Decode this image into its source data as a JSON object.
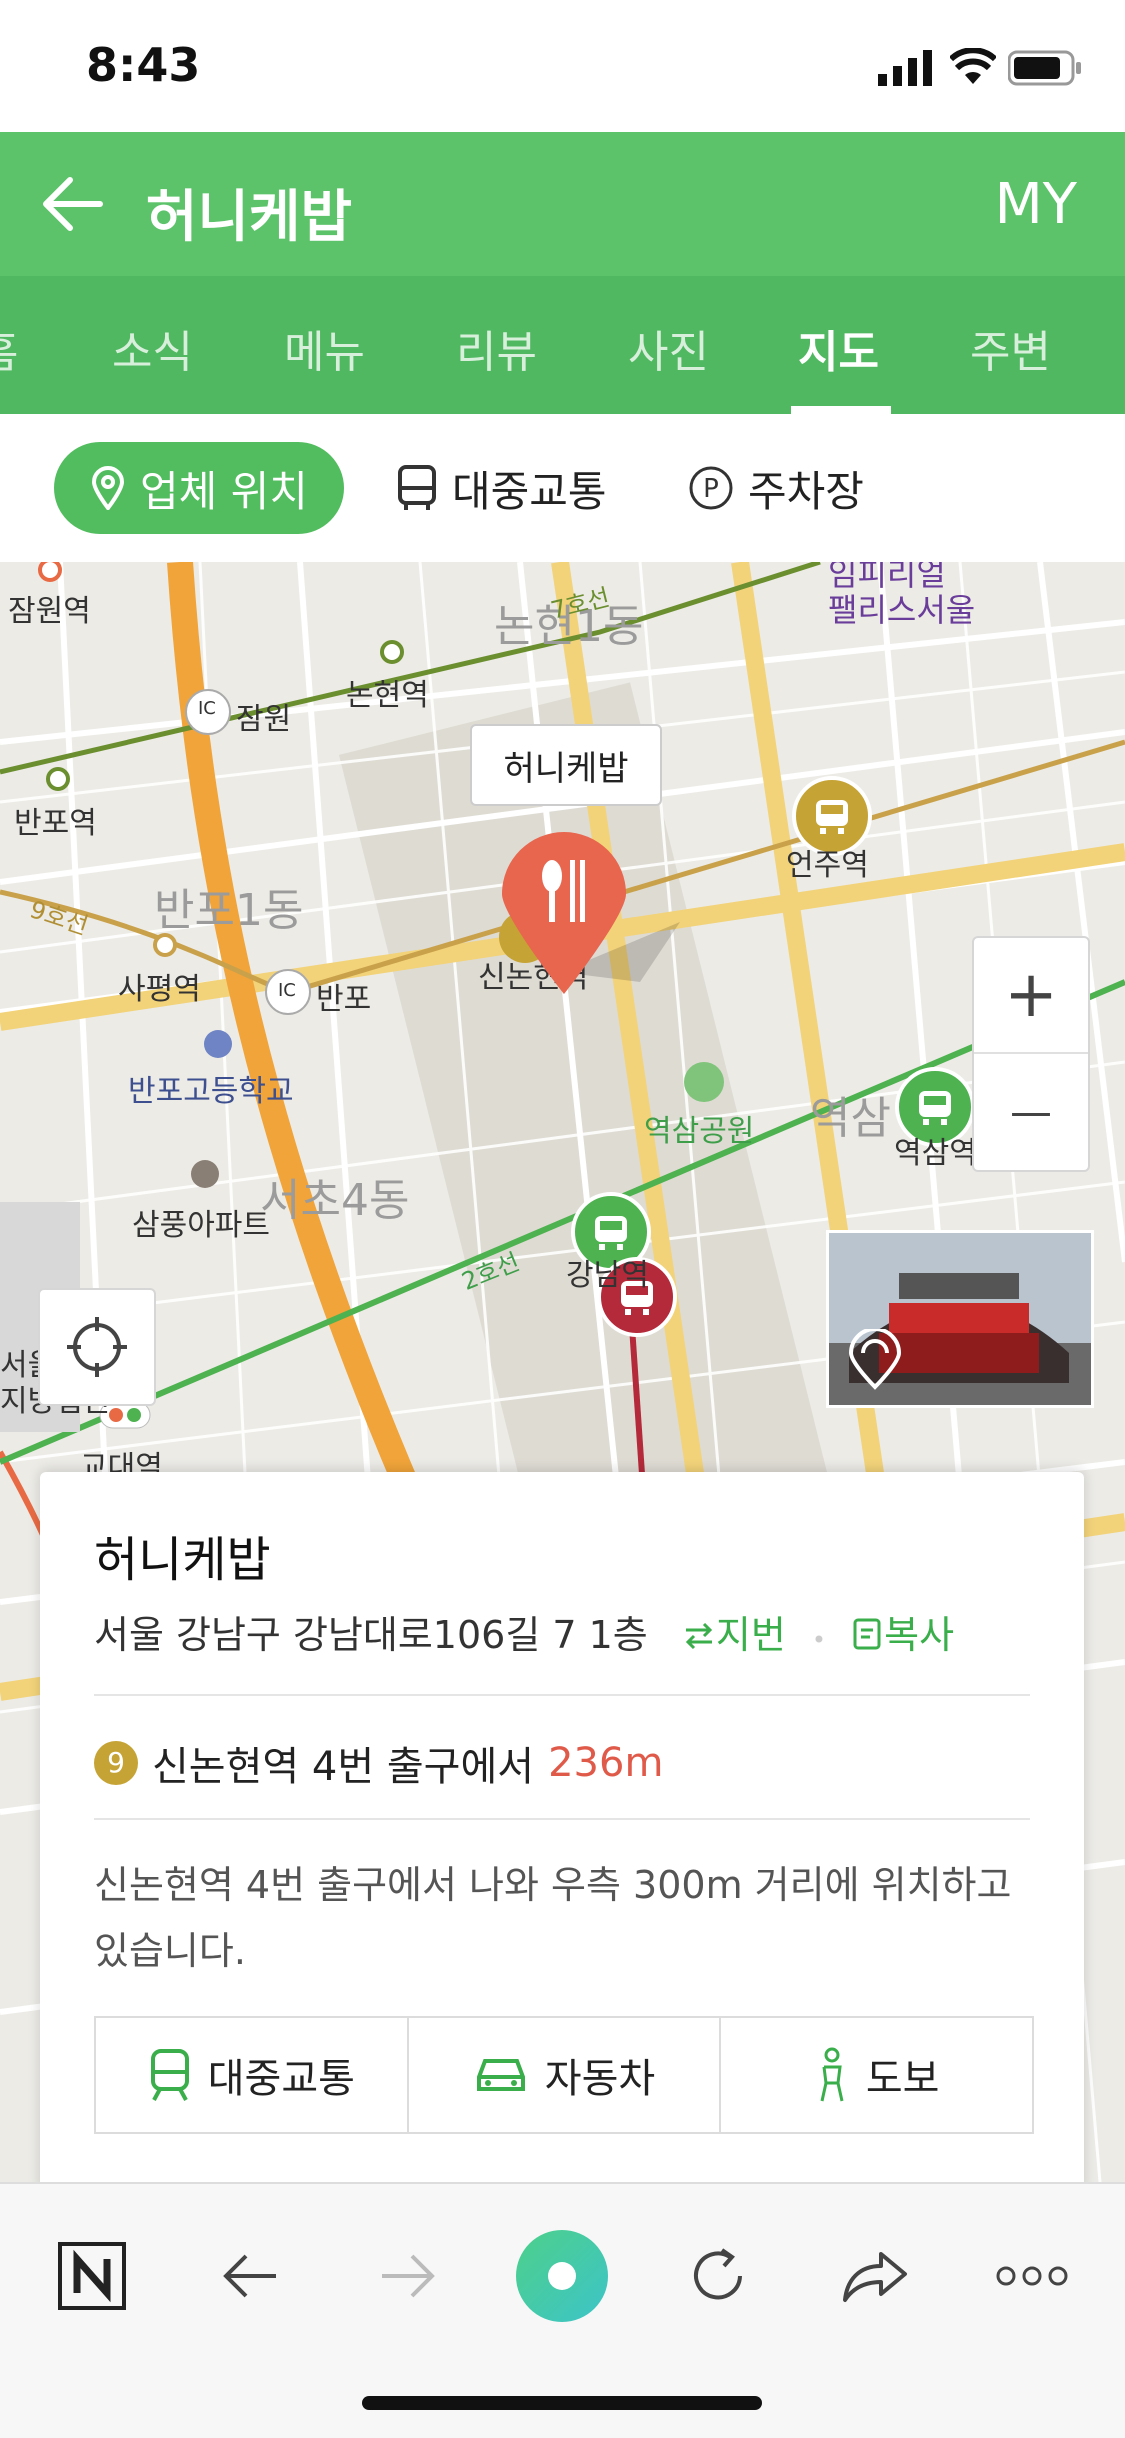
{
  "status_bar": {
    "time": "8:43"
  },
  "header": {
    "title": "허니케밥",
    "right_label": "MY"
  },
  "tabs": [
    {
      "label": "홈"
    },
    {
      "label": "소식"
    },
    {
      "label": "메뉴"
    },
    {
      "label": "리뷰"
    },
    {
      "label": "사진"
    },
    {
      "label": "지도",
      "active": true
    },
    {
      "label": "주변"
    }
  ],
  "chips": {
    "location": "업체 위치",
    "transit": "대중교통",
    "parking": "주차장"
  },
  "map": {
    "callout": "허니케밥",
    "labels": {
      "jamwon_station": "잠원역",
      "nonhyeon1": "논현1동",
      "nonhyeon_station": "논현역",
      "jamwon_ic": "잠원",
      "banpo_station": "반포역",
      "banpo1": "반포1동",
      "sapyeong": "사평역",
      "banpo_ic": "반포",
      "banpo_high": "반포고등학교",
      "sampoong": "삼풍아파트",
      "seocho4": "서초4동",
      "sinnonhyeon": "신논현역",
      "eonju": "언주역",
      "yeoksam_park": "역삼공원",
      "yeoksam": "역삼",
      "yeoksam_station": "역삼역",
      "gangnam": "강남역",
      "palace": "임피리얼\n팰리스서울",
      "line7": "7호선",
      "line9": "9호선",
      "line2": "2호선",
      "seoul_court": "서울중앙\n지방법원",
      "gyodae": "교대역",
      "ic": "IC"
    },
    "zoom_in": "+",
    "zoom_out": "—"
  },
  "card": {
    "name": "허니케밥",
    "address": "서울 강남구 강남대로106길 7 1층",
    "jibun": "지번",
    "copy": "복사",
    "line_badge": "9",
    "station_text": "신논현역 4번 출구에서",
    "distance": "236m",
    "description": "신논현역 4번 출구에서 나와 우측 300m 거리에 위치하고 있습니다.",
    "buttons": {
      "transit": "대중교통",
      "car": "자동차",
      "walk": "도보"
    }
  },
  "colors": {
    "brand_green": "#5cc36a",
    "tab_green": "#50b861",
    "distance_red": "#e05a4a",
    "pin_red": "#e8654e"
  }
}
